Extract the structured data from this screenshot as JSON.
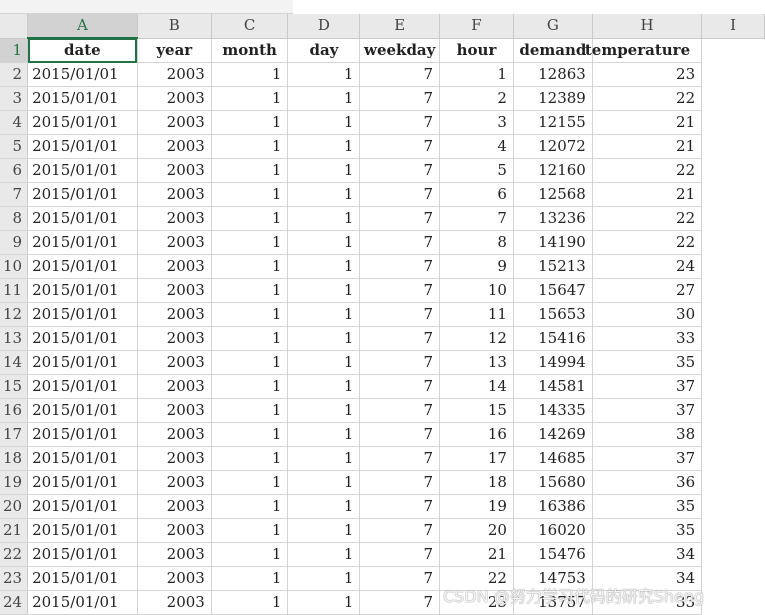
{
  "column_letters": [
    "A",
    "B",
    "C",
    "D",
    "E",
    "F",
    "G",
    "H",
    "I"
  ],
  "row_numbers": [
    "1",
    "2",
    "3",
    "4",
    "5",
    "6",
    "7",
    "8",
    "9",
    "10",
    "11",
    "12",
    "13",
    "14",
    "15",
    "16",
    "17",
    "18",
    "19",
    "20",
    "21",
    "22",
    "23",
    "24"
  ],
  "header_row": [
    "date",
    "year",
    "month",
    "day",
    "weekday",
    "hour",
    "demand",
    "temperature"
  ],
  "rows": [
    [
      "2015/01/01",
      "2003",
      "1",
      "1",
      "7",
      "1",
      "12863",
      "23"
    ],
    [
      "2015/01/01",
      "2003",
      "1",
      "1",
      "7",
      "2",
      "12389",
      "22"
    ],
    [
      "2015/01/01",
      "2003",
      "1",
      "1",
      "7",
      "3",
      "12155",
      "21"
    ],
    [
      "2015/01/01",
      "2003",
      "1",
      "1",
      "7",
      "4",
      "12072",
      "21"
    ],
    [
      "2015/01/01",
      "2003",
      "1",
      "1",
      "7",
      "5",
      "12160",
      "22"
    ],
    [
      "2015/01/01",
      "2003",
      "1",
      "1",
      "7",
      "6",
      "12568",
      "21"
    ],
    [
      "2015/01/01",
      "2003",
      "1",
      "1",
      "7",
      "7",
      "13236",
      "22"
    ],
    [
      "2015/01/01",
      "2003",
      "1",
      "1",
      "7",
      "8",
      "14190",
      "22"
    ],
    [
      "2015/01/01",
      "2003",
      "1",
      "1",
      "7",
      "9",
      "15213",
      "24"
    ],
    [
      "2015/01/01",
      "2003",
      "1",
      "1",
      "7",
      "10",
      "15647",
      "27"
    ],
    [
      "2015/01/01",
      "2003",
      "1",
      "1",
      "7",
      "11",
      "15653",
      "30"
    ],
    [
      "2015/01/01",
      "2003",
      "1",
      "1",
      "7",
      "12",
      "15416",
      "33"
    ],
    [
      "2015/01/01",
      "2003",
      "1",
      "1",
      "7",
      "13",
      "14994",
      "35"
    ],
    [
      "2015/01/01",
      "2003",
      "1",
      "1",
      "7",
      "14",
      "14581",
      "37"
    ],
    [
      "2015/01/01",
      "2003",
      "1",
      "1",
      "7",
      "15",
      "14335",
      "37"
    ],
    [
      "2015/01/01",
      "2003",
      "1",
      "1",
      "7",
      "16",
      "14269",
      "38"
    ],
    [
      "2015/01/01",
      "2003",
      "1",
      "1",
      "7",
      "17",
      "14685",
      "37"
    ],
    [
      "2015/01/01",
      "2003",
      "1",
      "1",
      "7",
      "18",
      "15680",
      "36"
    ],
    [
      "2015/01/01",
      "2003",
      "1",
      "1",
      "7",
      "19",
      "16386",
      "35"
    ],
    [
      "2015/01/01",
      "2003",
      "1",
      "1",
      "7",
      "20",
      "16020",
      "35"
    ],
    [
      "2015/01/01",
      "2003",
      "1",
      "1",
      "7",
      "21",
      "15476",
      "34"
    ],
    [
      "2015/01/01",
      "2003",
      "1",
      "1",
      "7",
      "22",
      "14753",
      "34"
    ],
    [
      "2015/01/01",
      "2003",
      "1",
      "1",
      "7",
      "23",
      "13757",
      "33"
    ]
  ],
  "watermark": "CSDN @努力学习代码的研究Sheng",
  "colors": {
    "accent": "#217346",
    "header_bg": "#e9e9e9",
    "gridline": "#d4d4d4"
  }
}
